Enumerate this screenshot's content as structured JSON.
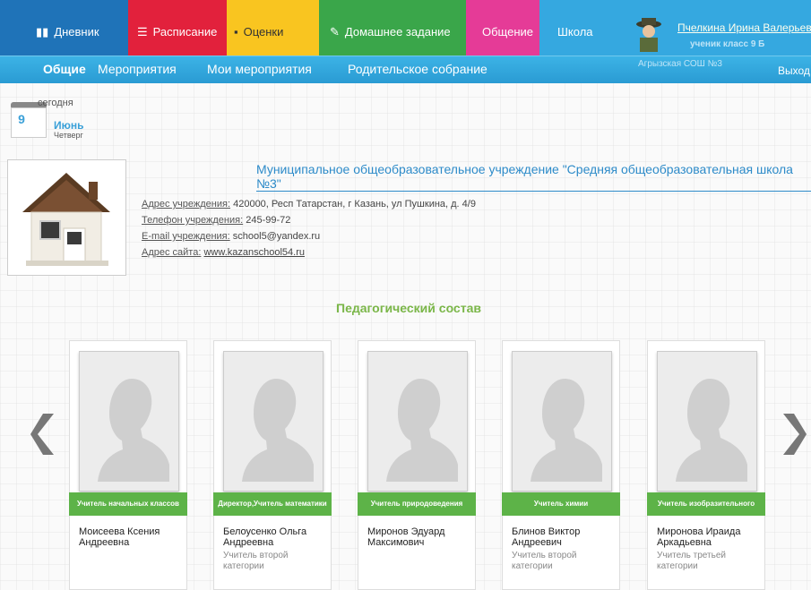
{
  "nav": {
    "tabs": [
      {
        "label": "Дневник"
      },
      {
        "label": "Расписание"
      },
      {
        "label": "Оценки"
      },
      {
        "label": "Домашнее задание"
      },
      {
        "label": "Общение"
      },
      {
        "label": "Школа"
      }
    ],
    "subtabs": [
      "Общие",
      "Мероприятия",
      "Мои мероприятия",
      "Родительское собрание"
    ],
    "user": {
      "name": "Пчелкина Ирина Валерьевн",
      "role": "ученик класс 9 Б",
      "school": "Агрызская СОШ №3",
      "logout": "Выход"
    }
  },
  "date": {
    "today_label": "сегодня",
    "day": "9",
    "month": "Июнь",
    "weekday": "Четверг"
  },
  "school": {
    "title": "Муниципальное общеобразовательное учреждение \"Средняя общеобразовательная школа №3\"",
    "address_label": "Адрес учреждения:",
    "address": "420000, Респ Татарстан, г Казань, ул Пушкина, д. 4/9",
    "phone_label": "Телефон учреждения:",
    "phone": "245-99-72",
    "email_label": "E-mail учреждения:",
    "email": "school5@yandex.ru",
    "site_label": "Адрес сайта:",
    "site": "www.kazanschool54.ru"
  },
  "staff": {
    "title": "Педагогический состав",
    "cards": [
      {
        "role": "Учитель начальных классов",
        "name": "Моисеева Ксения Андреевна",
        "category": ""
      },
      {
        "role": "Директор,Учитель математики",
        "name": "Белоусенко Ольга Андреевна",
        "category": "Учитель второй категории"
      },
      {
        "role": "Учитель природоведения",
        "name": "Миронов Эдуард Максимович",
        "category": ""
      },
      {
        "role": "Учитель химии",
        "name": "Блинов Виктор Андреевич",
        "category": "Учитель второй категории"
      },
      {
        "role": "Учитель изобразительного",
        "name": "Миронова Ираида Аркадьевна",
        "category": "Учитель третьей категории"
      }
    ]
  },
  "icons": {
    "prev": "chevron-left-icon",
    "next": "chevron-right-icon"
  }
}
